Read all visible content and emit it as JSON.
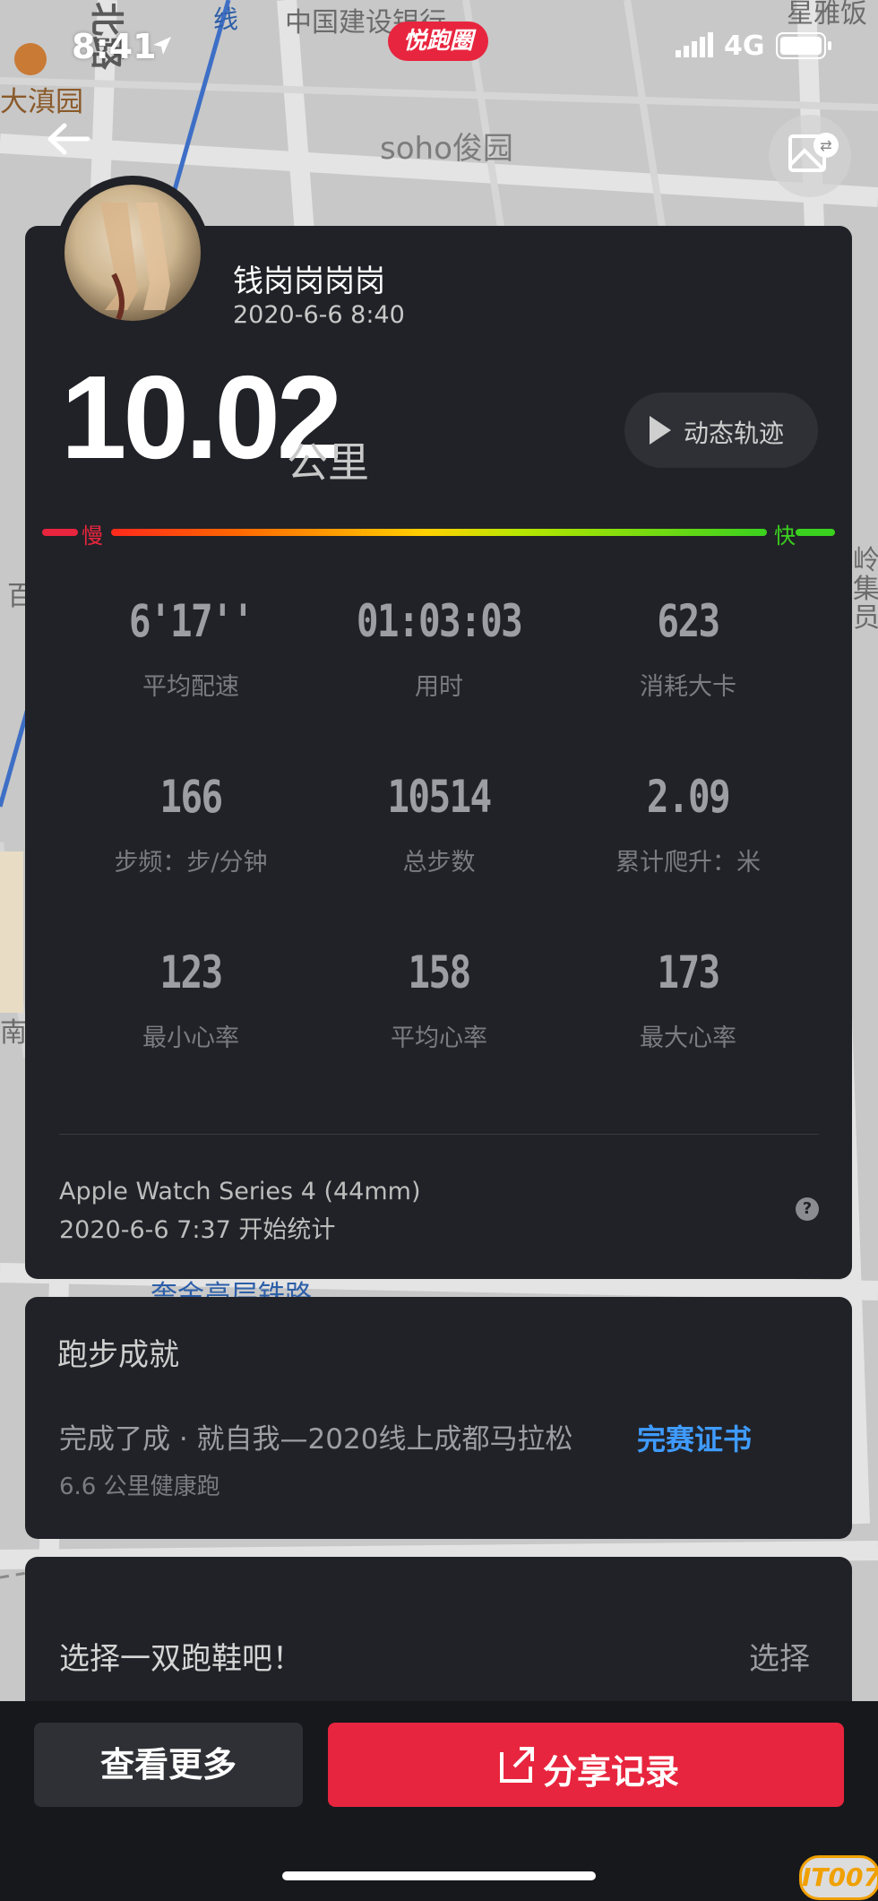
{
  "status_bar": {
    "time": "8:41",
    "app_badge": "悦跑圈",
    "network": "4G"
  },
  "map": {
    "labels": {
      "bei_road": "北路",
      "bank": "中国建设银行",
      "dadian": "大滇园",
      "soho": "soho俊园",
      "xian": "线",
      "xingyin": "星雅饭",
      "nan": "南铁",
      "gaoceng": "奎金高层铁路",
      "ling": "岭",
      "ji": "集",
      "yuan": "员",
      "bai": "百"
    }
  },
  "profile": {
    "username": "钱岗岗岗岗",
    "datetime": "2020-6-6 8:40"
  },
  "summary": {
    "distance": "10.02",
    "unit": "公里",
    "track_label": "动态轨迹",
    "pace_slow": "慢",
    "pace_fast": "快"
  },
  "stats": [
    {
      "value": "6'17''",
      "label": "平均配速"
    },
    {
      "value": "01:03:03",
      "label": "用时"
    },
    {
      "value": "623",
      "label": "消耗大卡"
    },
    {
      "value": "166",
      "label": "步频：步/分钟"
    },
    {
      "value": "10514",
      "label": "总步数"
    },
    {
      "value": "2.09",
      "label": "累计爬升：米"
    },
    {
      "value": "123",
      "label": "最小心率"
    },
    {
      "value": "158",
      "label": "平均心率"
    },
    {
      "value": "173",
      "label": "最大心率"
    }
  ],
  "device": {
    "name": "Apple Watch Series 4 (44mm)",
    "start": "2020-6-6 7:37 开始统计",
    "help": "?"
  },
  "achievement": {
    "title": "跑步成就",
    "text": "完成了成 · 就自我—2020线上成都马拉松",
    "link": "完赛证书",
    "sub": "6.6 公里健康跑"
  },
  "shoe": {
    "prompt": "选择一双跑鞋吧！",
    "action": "选择"
  },
  "bottom": {
    "more": "查看更多",
    "share": "分享记录"
  },
  "watermark": "IT007",
  "colors": {
    "card": "#212227",
    "accent_red": "#e8253e",
    "link_blue": "#3f9bff",
    "pace_green": "#3bd11f"
  }
}
